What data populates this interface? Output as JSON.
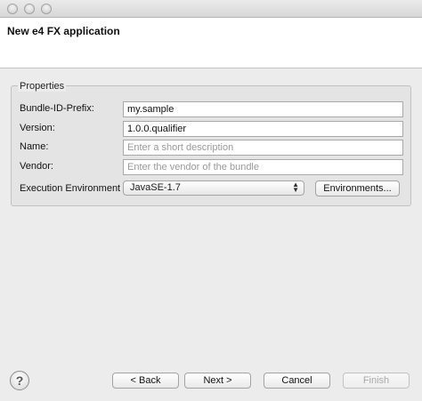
{
  "header": {
    "title": "New e4 FX application"
  },
  "group": {
    "label": "Properties"
  },
  "fields": [
    {
      "label": "Bundle-ID-Prefix:",
      "value": "my.sample",
      "placeholder": ""
    },
    {
      "label": "Version:",
      "value": "1.0.0.qualifier",
      "placeholder": ""
    },
    {
      "label": "Name:",
      "value": "",
      "placeholder": "Enter a short description"
    },
    {
      "label": "Vendor:",
      "value": "",
      "placeholder": "Enter the vendor of the bundle"
    }
  ],
  "environment": {
    "label": "Execution Environment",
    "selected": "JavaSE-1.7",
    "button": "Environments..."
  },
  "footer": {
    "help": "?",
    "back": "< Back",
    "next": "Next >",
    "cancel": "Cancel",
    "finish": "Finish"
  }
}
